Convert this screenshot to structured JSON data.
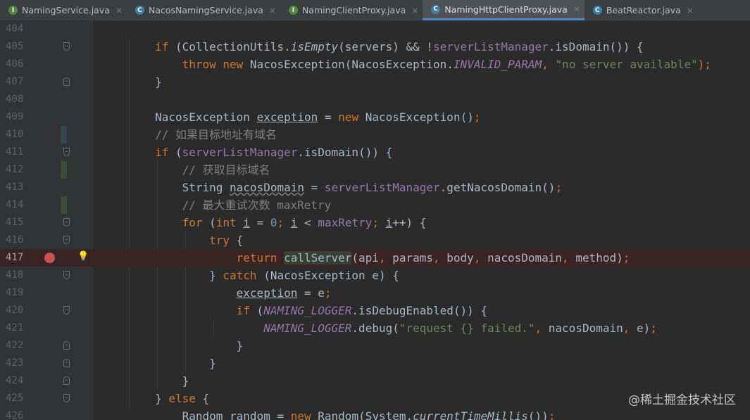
{
  "tabs": [
    {
      "label": "NamingService.java",
      "kind": "I",
      "active": false
    },
    {
      "label": "NacosNamingService.java",
      "kind": "C",
      "active": false
    },
    {
      "label": "NamingClientProxy.java",
      "kind": "I",
      "active": false
    },
    {
      "label": "NamingHttpClientProxy.java",
      "kind": "C",
      "active": true
    },
    {
      "label": "BeatReactor.java",
      "kind": "C",
      "active": false
    }
  ],
  "close_glyph": "×",
  "lines": [
    {
      "num": "404",
      "segs": []
    },
    {
      "num": "405",
      "segs": [
        [
          "        ",
          ""
        ],
        [
          "if",
          "kw"
        ],
        [
          " (CollectionUtils.",
          ""
        ],
        [
          "isEmpty",
          "it"
        ],
        [
          "(servers) && !",
          ""
        ],
        [
          "serverListManager",
          "fi"
        ],
        [
          ".isDomain()) {",
          ""
        ]
      ]
    },
    {
      "num": "406",
      "segs": [
        [
          "            ",
          ""
        ],
        [
          "throw new",
          "kw"
        ],
        [
          " NacosException(NacosException.",
          ""
        ],
        [
          "INVALID_PARAM",
          "fi it"
        ],
        [
          ", ",
          "kw"
        ],
        [
          "\"no server available\"",
          "st"
        ],
        [
          ");",
          "kw"
        ]
      ]
    },
    {
      "num": "407",
      "segs": [
        [
          "        }",
          ""
        ]
      ]
    },
    {
      "num": "408",
      "segs": []
    },
    {
      "num": "409",
      "segs": [
        [
          "        NacosException ",
          ""
        ],
        [
          "exception",
          "ul"
        ],
        [
          " = ",
          ""
        ],
        [
          "new",
          "kw"
        ],
        [
          " NacosException()",
          ""
        ],
        [
          ";",
          "kw"
        ]
      ]
    },
    {
      "num": "410",
      "segs": [
        [
          "        // 如果目标地址有域名",
          "cm"
        ]
      ]
    },
    {
      "num": "411",
      "segs": [
        [
          "        ",
          ""
        ],
        [
          "if",
          "kw"
        ],
        [
          " (",
          ""
        ],
        [
          "serverListManager",
          "fi"
        ],
        [
          ".isDomain()) {",
          ""
        ]
      ]
    },
    {
      "num": "412",
      "segs": [
        [
          "            // 获取目标域名",
          "cm"
        ]
      ]
    },
    {
      "num": "413",
      "segs": [
        [
          "            String ",
          ""
        ],
        [
          "nacosDomain",
          "wv"
        ],
        [
          " = ",
          ""
        ],
        [
          "serverListManager",
          "fi"
        ],
        [
          ".getNacosDomain()",
          ""
        ],
        [
          ";",
          "kw"
        ]
      ]
    },
    {
      "num": "414",
      "segs": [
        [
          "            // 最大重试次数 maxRetry",
          "cm"
        ]
      ]
    },
    {
      "num": "415",
      "segs": [
        [
          "            ",
          ""
        ],
        [
          "for",
          "kw"
        ],
        [
          " (",
          ""
        ],
        [
          "int",
          "kw"
        ],
        [
          " ",
          ""
        ],
        [
          "i",
          "ul"
        ],
        [
          " = ",
          ""
        ],
        [
          "0",
          "nm"
        ],
        [
          "; ",
          "kw"
        ],
        [
          "i",
          "ul"
        ],
        [
          " < ",
          ""
        ],
        [
          "maxRetry",
          "fi"
        ],
        [
          "; ",
          "kw"
        ],
        [
          "i",
          "ul"
        ],
        [
          "++) {",
          ""
        ]
      ]
    },
    {
      "num": "416",
      "segs": [
        [
          "                ",
          ""
        ],
        [
          "try",
          "kw"
        ],
        [
          " {",
          ""
        ]
      ]
    },
    {
      "num": "417",
      "segs": [
        [
          "                    ",
          ""
        ],
        [
          "return",
          "kw"
        ],
        [
          " ",
          ""
        ],
        [
          "callServer",
          "hl"
        ],
        [
          "(api",
          ""
        ],
        [
          ", ",
          "kw"
        ],
        [
          "params",
          ""
        ],
        [
          ", ",
          "kw"
        ],
        [
          "body",
          ""
        ],
        [
          ", ",
          "kw"
        ],
        [
          "nacosDomain",
          ""
        ],
        [
          ", ",
          "kw"
        ],
        [
          "method)",
          ""
        ],
        [
          ";",
          "kw"
        ]
      ]
    },
    {
      "num": "418",
      "segs": [
        [
          "                } ",
          ""
        ],
        [
          "catch",
          "kw"
        ],
        [
          " (NacosException e) {",
          ""
        ]
      ]
    },
    {
      "num": "419",
      "segs": [
        [
          "                    ",
          ""
        ],
        [
          "exception",
          "ul"
        ],
        [
          " = e",
          ""
        ],
        [
          ";",
          "kw"
        ]
      ]
    },
    {
      "num": "420",
      "segs": [
        [
          "                    ",
          ""
        ],
        [
          "if",
          "kw"
        ],
        [
          " (",
          ""
        ],
        [
          "NAMING_LOGGER",
          "fi it"
        ],
        [
          ".isDebugEnabled()) {",
          ""
        ]
      ]
    },
    {
      "num": "421",
      "segs": [
        [
          "                        ",
          ""
        ],
        [
          "NAMING_LOGGER",
          "fi it"
        ],
        [
          ".debug(",
          ""
        ],
        [
          "\"request {} failed.\"",
          "st"
        ],
        [
          ", ",
          "kw"
        ],
        [
          "nacosDomain",
          ""
        ],
        [
          ", ",
          "kw"
        ],
        [
          "e)",
          ""
        ],
        [
          ";",
          "kw"
        ]
      ]
    },
    {
      "num": "422",
      "segs": [
        [
          "                    }",
          ""
        ]
      ]
    },
    {
      "num": "423",
      "segs": [
        [
          "                }",
          ""
        ]
      ]
    },
    {
      "num": "424",
      "segs": [
        [
          "            }",
          ""
        ]
      ]
    },
    {
      "num": "425",
      "segs": [
        [
          "        } ",
          ""
        ],
        [
          "else",
          "kw"
        ],
        [
          " {",
          ""
        ]
      ]
    },
    {
      "num": "426",
      "segs": [
        [
          "            Random ",
          ""
        ],
        [
          "random",
          "ul"
        ],
        [
          " = ",
          ""
        ],
        [
          "new",
          "kw"
        ],
        [
          " Random(System.",
          ""
        ],
        [
          "currentTimeMillis",
          "it"
        ],
        [
          "())",
          ""
        ],
        [
          ";",
          "kw"
        ]
      ]
    }
  ],
  "watermark": "@稀土掘金技术社区",
  "colors": {
    "keyword": "#cc7832",
    "string": "#6a8759",
    "comment": "#808080",
    "field": "#9876aa",
    "number": "#6897bb",
    "breakpoint": "#c75450"
  }
}
